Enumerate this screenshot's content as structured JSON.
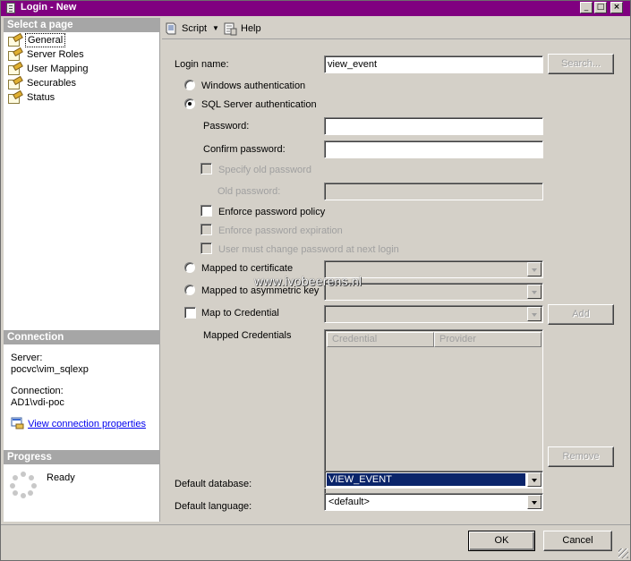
{
  "window": {
    "title": "Login - New"
  },
  "left": {
    "select_page_header": "Select a page",
    "pages": [
      {
        "label": "General",
        "selected": true
      },
      {
        "label": "Server Roles",
        "selected": false
      },
      {
        "label": "User Mapping",
        "selected": false
      },
      {
        "label": "Securables",
        "selected": false
      },
      {
        "label": "Status",
        "selected": false
      }
    ],
    "connection_header": "Connection",
    "server_label": "Server:",
    "server_value": "pocvc\\vim_sqlexp",
    "connection_label": "Connection:",
    "connection_value": "AD1\\vdi-poc",
    "view_props_link": "View connection properties",
    "progress_header": "Progress",
    "progress_status": "Ready"
  },
  "toolbar": {
    "script_label": "Script",
    "help_label": "Help"
  },
  "form": {
    "login_name_label": "Login name:",
    "login_name_value": "view_event",
    "search_button": "Search...",
    "windows_auth": "Windows authentication",
    "sql_auth": "SQL Server authentication",
    "auth_selected": "sql",
    "password_label": "Password:",
    "password_value": "",
    "confirm_label": "Confirm password:",
    "confirm_value": "",
    "specify_old": "Specify old password",
    "old_password_label": "Old password:",
    "enforce_policy": "Enforce password policy",
    "enforce_policy_checked": false,
    "enforce_expiration": "Enforce password expiration",
    "must_change": "User must change password at next login",
    "mapped_cert": "Mapped to certificate",
    "mapped_asym": "Mapped to asymmetric key",
    "map_credential": "Map to Credential",
    "add_button": "Add",
    "mapped_credentials_label": "Mapped Credentials",
    "grid_columns": [
      "Credential",
      "Provider"
    ],
    "remove_button": "Remove",
    "default_db_label": "Default database:",
    "default_db_value": "VIEW_EVENT",
    "default_lang_label": "Default language:",
    "default_lang_value": "<default>"
  },
  "watermark": "www.ivobeerens.nl",
  "buttons": {
    "ok": "OK",
    "cancel": "Cancel"
  }
}
